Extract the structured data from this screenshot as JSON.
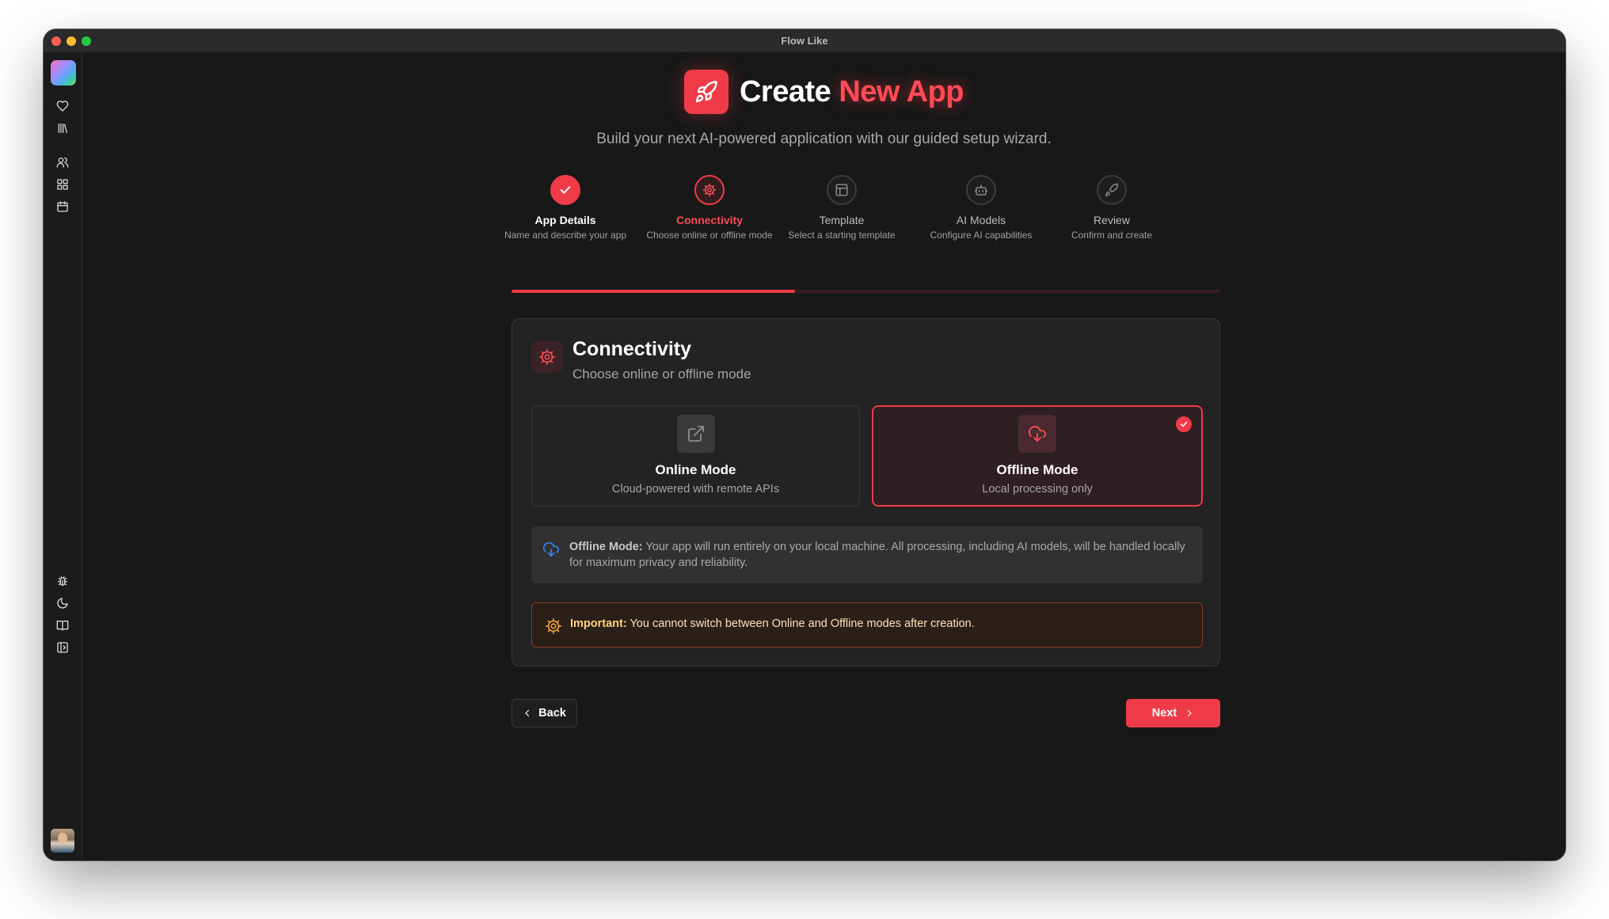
{
  "window": {
    "title": "Flow Like"
  },
  "header": {
    "title_prefix": "Create",
    "title_accent": "New App",
    "subtitle": "Build your next AI-powered application with our guided setup wizard."
  },
  "steps": [
    {
      "title": "App Details",
      "description": "Name and describe your app",
      "state": "done",
      "icon": "check-icon"
    },
    {
      "title": "Connectivity",
      "description": "Choose online or offline mode",
      "state": "active",
      "icon": "gear-icon"
    },
    {
      "title": "Template",
      "description": "Select a starting template",
      "state": "pending",
      "icon": "template-icon"
    },
    {
      "title": "AI Models",
      "description": "Configure AI capabilities",
      "state": "pending",
      "icon": "bot-icon"
    },
    {
      "title": "Review",
      "description": "Confirm and create",
      "state": "pending",
      "icon": "rocket-icon"
    }
  ],
  "progress": {
    "fraction": 0.4
  },
  "card": {
    "title": "Connectivity",
    "subtitle": "Choose online or offline mode",
    "options": [
      {
        "title": "Online Mode",
        "description": "Cloud-powered with remote APIs",
        "selected": false,
        "icon": "external-link-icon"
      },
      {
        "title": "Offline Mode",
        "description": "Local processing only",
        "selected": true,
        "icon": "cloud-download-icon"
      }
    ],
    "info": {
      "label": "Offline Mode:",
      "text": "Your app will run entirely on your local machine. All processing, including AI models, will be handled locally for maximum privacy and reliability."
    },
    "warning": {
      "label": "Important:",
      "text": "You cannot switch between Online and Offline modes after creation."
    }
  },
  "buttons": {
    "back": "Back",
    "next": "Next"
  },
  "sidebar": {
    "top_icons": [
      "heart-icon",
      "library-icon",
      "users-icon",
      "apps-icon",
      "calendar-icon"
    ],
    "bottom_icons": [
      "bug-icon",
      "moon-icon",
      "book-icon",
      "panel-icon"
    ]
  },
  "colors": {
    "accent": "#ef3b48",
    "background": "#181818",
    "info": "#3b82f6",
    "warning": "#f0a030"
  }
}
